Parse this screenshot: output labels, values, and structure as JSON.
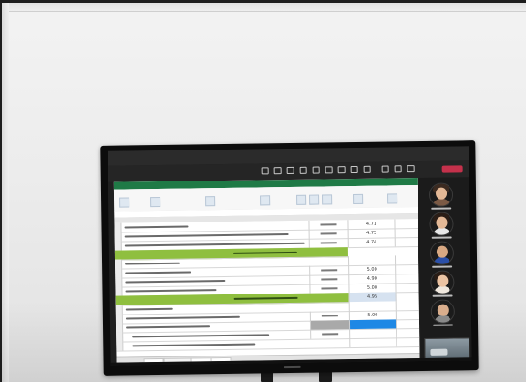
{
  "colors": {
    "wall": "#ededed",
    "tv_bezel": "#0c0c0c",
    "teams_leave_button": "#c4314b",
    "excel_green": "#1f7a46",
    "section_band": "#8fbf3f",
    "selected_cell": "#1e88e5"
  },
  "spreadsheet": {
    "values": [
      "4.71",
      "4.75",
      "4.74",
      "5.00",
      "4.90",
      "5.00",
      "4.95",
      "5.00"
    ]
  }
}
